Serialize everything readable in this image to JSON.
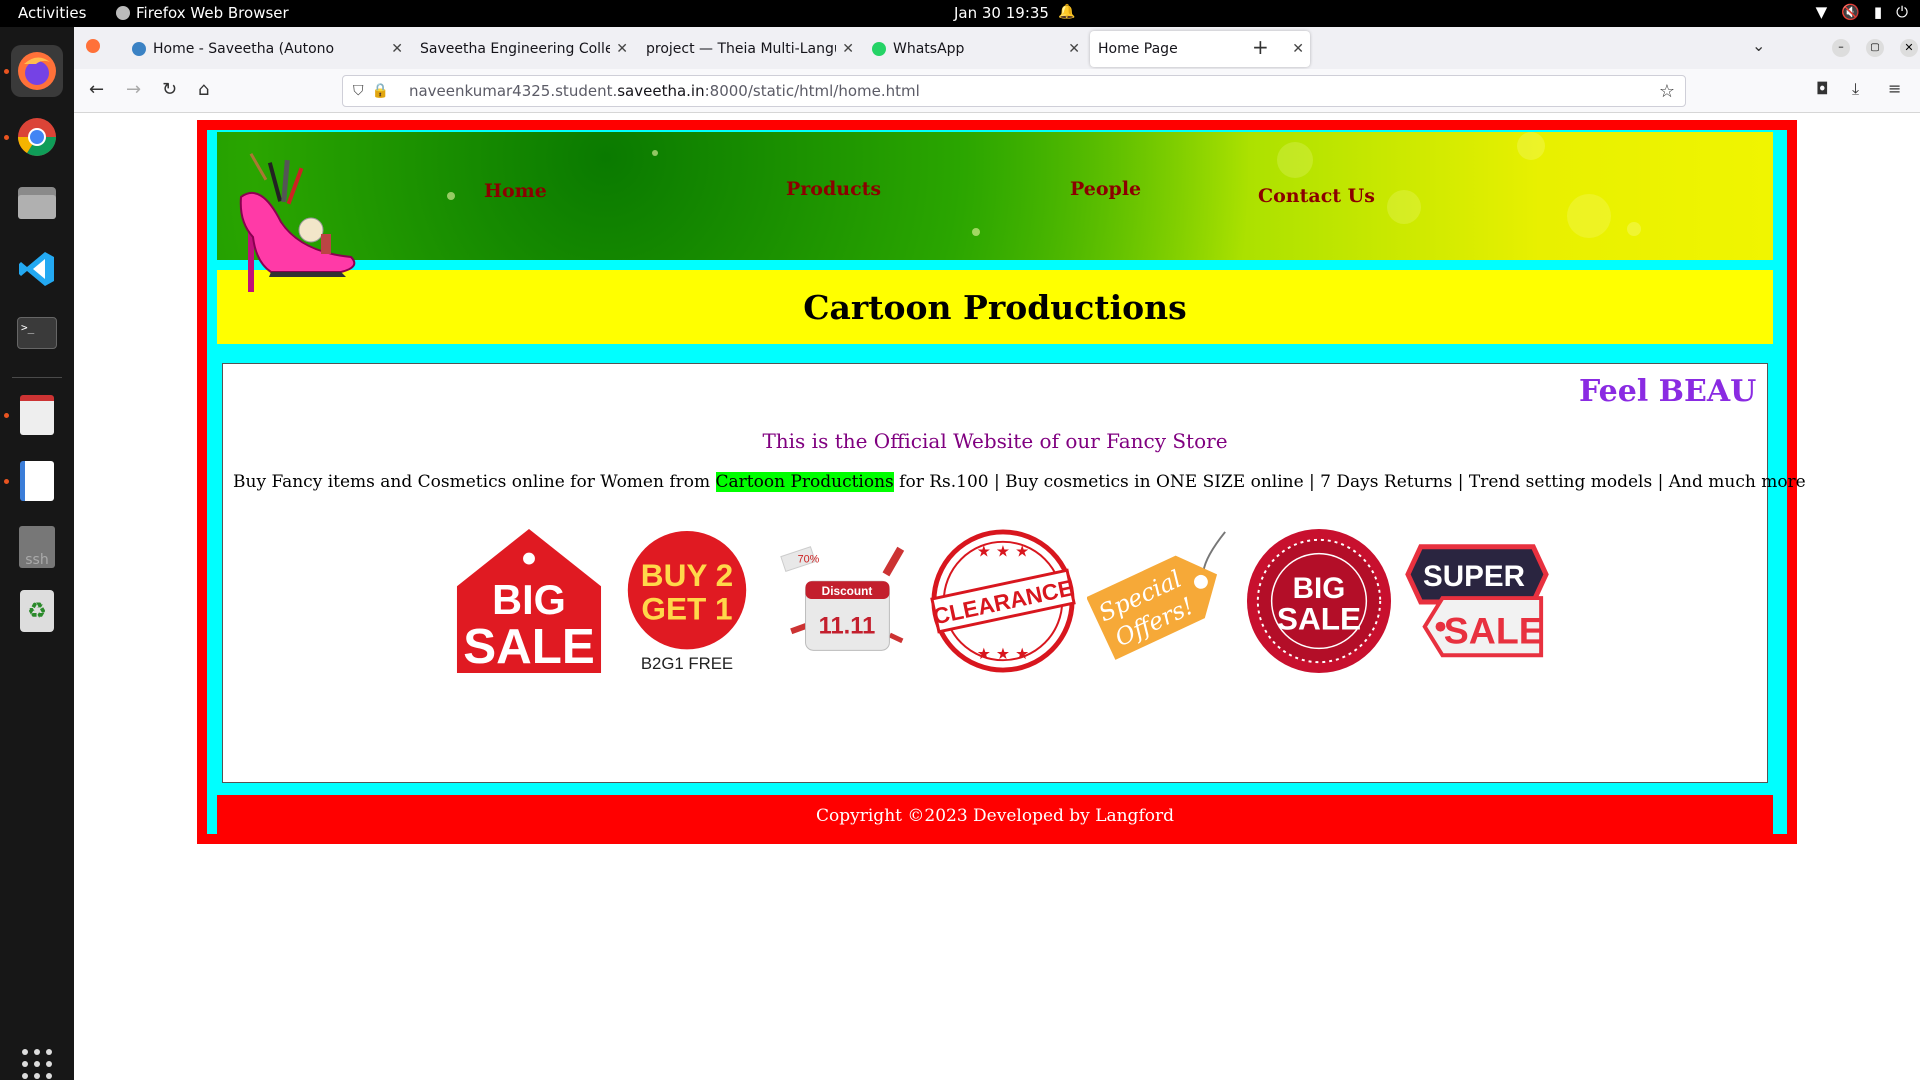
{
  "topbar": {
    "activities": "Activities",
    "app_name": "Firefox Web Browser",
    "clock": "Jan 30  19:35"
  },
  "browser": {
    "tabs": [
      {
        "label": "Home - Saveetha (Autono",
        "favicon_color": "#3b82c4"
      },
      {
        "label": "Saveetha Engineering Colleg",
        "favicon_color": ""
      },
      {
        "label": "project — Theia Multi-Langu",
        "favicon_color": ""
      },
      {
        "label": "WhatsApp",
        "favicon_color": "#25d366"
      },
      {
        "label": "Home Page",
        "favicon_color": ""
      }
    ],
    "url_prefix": "naveenkumar4325.student.",
    "url_domain": "saveetha.in",
    "url_suffix": ":8000/static/html/home.html"
  },
  "site": {
    "nav": {
      "home": "Home",
      "products": "Products",
      "people": "People",
      "contact": "Contact Us"
    },
    "title": "Cartoon Productions",
    "marquee": "Feel BEAU'",
    "official": "This is the Official Website of our Fancy Store",
    "desc_before": "Buy Fancy items and Cosmetics online for Women from ",
    "desc_highlight": "Cartoon Productions",
    "desc_after": " for Rs.100 | Buy cosmetics in ONE SIZE online | 7 Days Returns | Trend setting models | And much more",
    "badges": {
      "big_sale_1": [
        "BIG",
        "SALE"
      ],
      "buy2get1": [
        "BUY 2",
        "GET 1",
        "B2G1 FREE"
      ],
      "discount": [
        "70%",
        "Discount",
        "11.11"
      ],
      "clearance": "CLEARANCE",
      "special": [
        "Special",
        "Offers!"
      ],
      "big_sale_2": [
        "BIG",
        "SALE"
      ],
      "super_sale": [
        "SUPER",
        "SALE"
      ]
    },
    "footer": "Copyright ©2023 Developed by Langford"
  },
  "colors": {
    "frame_red": "#ff0000",
    "inner_cyan": "#00ffff",
    "title_yellow": "#ffff00",
    "nav_text": "#8b0000",
    "marquee_text": "#8a2be2",
    "official_text": "#800080",
    "highlight": "#00ff00"
  }
}
